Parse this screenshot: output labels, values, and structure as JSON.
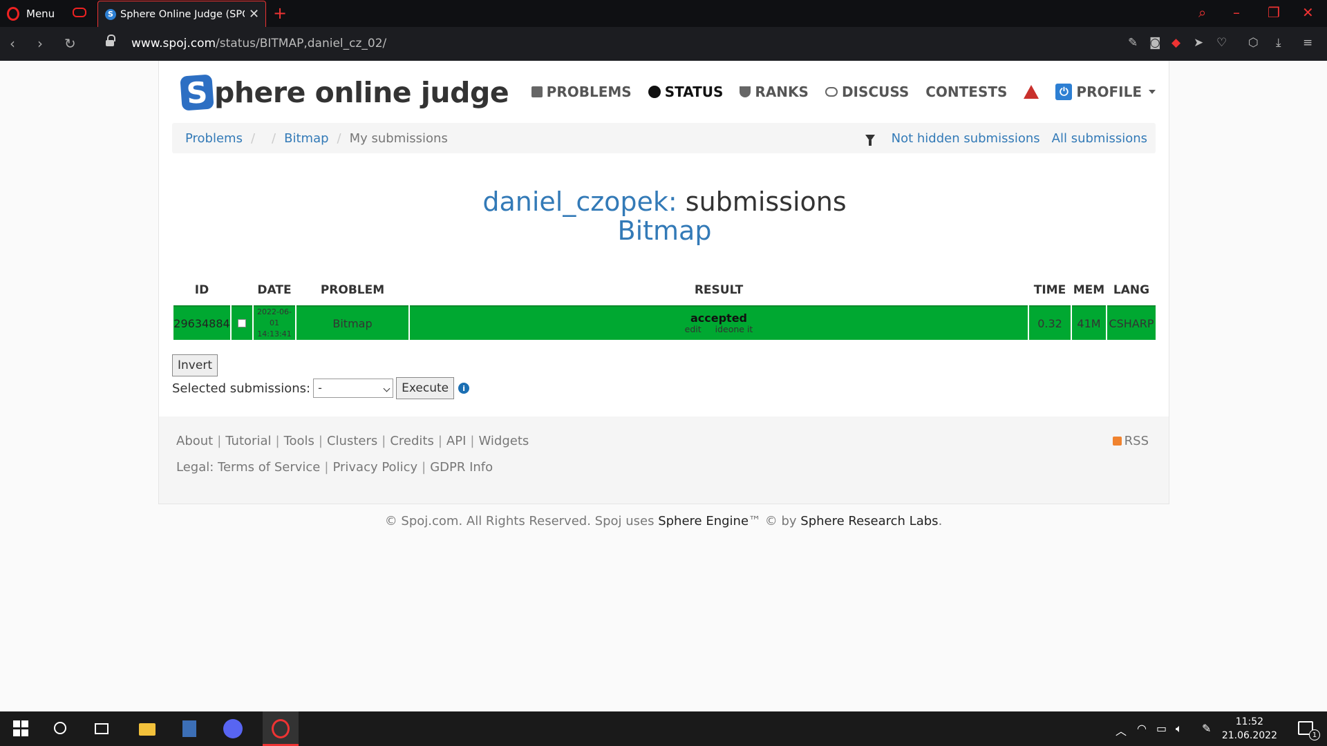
{
  "browser": {
    "menu_label": "Menu",
    "tab_title": "Sphere Online Judge (SPOJ)",
    "tab_favicon": "S",
    "url_domain": "www.spoj.com",
    "url_path": "/status/BITMAP,daniel_cz_02/"
  },
  "site": {
    "logo_letter": "S",
    "logo_text": "phere online judge",
    "nav": {
      "problems": "PROBLEMS",
      "status": "STATUS",
      "ranks": "RANKS",
      "discuss": "DISCUSS",
      "contests": "CONTESTS",
      "profile": "PROFILE"
    }
  },
  "breadcrumb": {
    "problems": "Problems",
    "bitmap": "Bitmap",
    "current": "My submissions",
    "not_hidden": "Not hidden submissions",
    "all": "All submissions"
  },
  "heading": {
    "user": "daniel_czopek:",
    "suffix": " submissions",
    "problem": "Bitmap"
  },
  "table": {
    "headers": {
      "id": "ID",
      "date": "DATE",
      "problem": "PROBLEM",
      "result": "RESULT",
      "time": "TIME",
      "mem": "MEM",
      "lang": "LANG"
    },
    "rows": [
      {
        "id": "29634884",
        "date": "2022-06-01",
        "time_of_day": "14:13:41",
        "problem": "Bitmap",
        "result": "accepted",
        "link_edit": "edit",
        "link_ideone": "ideone it",
        "time": "0.32",
        "mem": "41M",
        "lang": "CSHARP"
      }
    ],
    "row_color": "#00a831"
  },
  "actions": {
    "invert": "Invert",
    "selected_label": "Selected submissions:",
    "select_value": "-",
    "execute": "Execute"
  },
  "footer": {
    "about": "About",
    "tutorial": "Tutorial",
    "tools": "Tools",
    "clusters": "Clusters",
    "credits": "Credits",
    "api": "API",
    "widgets": "Widgets",
    "rss": "RSS",
    "legal_prefix": "Legal:",
    "terms": "Terms of Service",
    "privacy": "Privacy Policy",
    "gdpr": "GDPR Info",
    "copy_prefix": "© Spoj.com. All Rights Reserved. Spoj uses ",
    "engine": "Sphere Engine",
    "copy_mid": "™ © by ",
    "labs": "Sphere Research Labs",
    "copy_end": "."
  },
  "taskbar": {
    "time": "11:52",
    "date": "21.06.2022",
    "notif_count": "1"
  }
}
